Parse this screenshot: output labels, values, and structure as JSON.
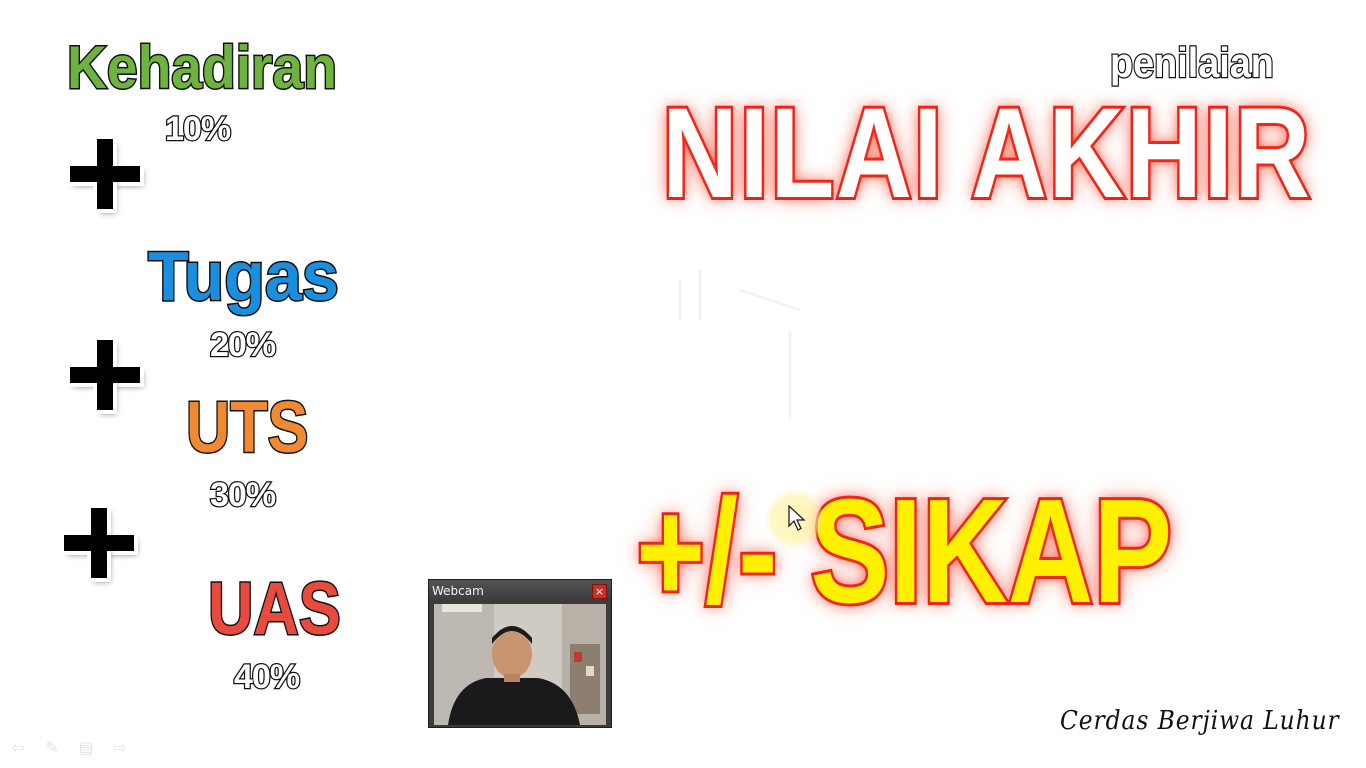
{
  "slide": {
    "items": [
      {
        "label": "Kehadiran",
        "percent": "10%",
        "color": "#6fb33f"
      },
      {
        "label": "Tugas",
        "percent": "20%",
        "color": "#1a8fe0"
      },
      {
        "label": "UTS",
        "percent": "30%",
        "color": "#f08a32"
      },
      {
        "label": "UAS",
        "percent": "40%",
        "color": "#e94a3e"
      }
    ],
    "penilaian": "penilaian",
    "title": "NILAI AKHIR",
    "modifier": "+/- SIKAP",
    "motto": "Cerdas Berjiwa Luhur",
    "accent_red": "#e8201a",
    "accent_yellow": "#ffef00"
  },
  "webcam": {
    "title": "Webcam",
    "close_label": "×"
  },
  "controls": {
    "previous_icon": "arrow-left-icon",
    "pen_icon": "pen-icon",
    "menu_icon": "menu-icon",
    "next_icon": "arrow-right-icon"
  }
}
